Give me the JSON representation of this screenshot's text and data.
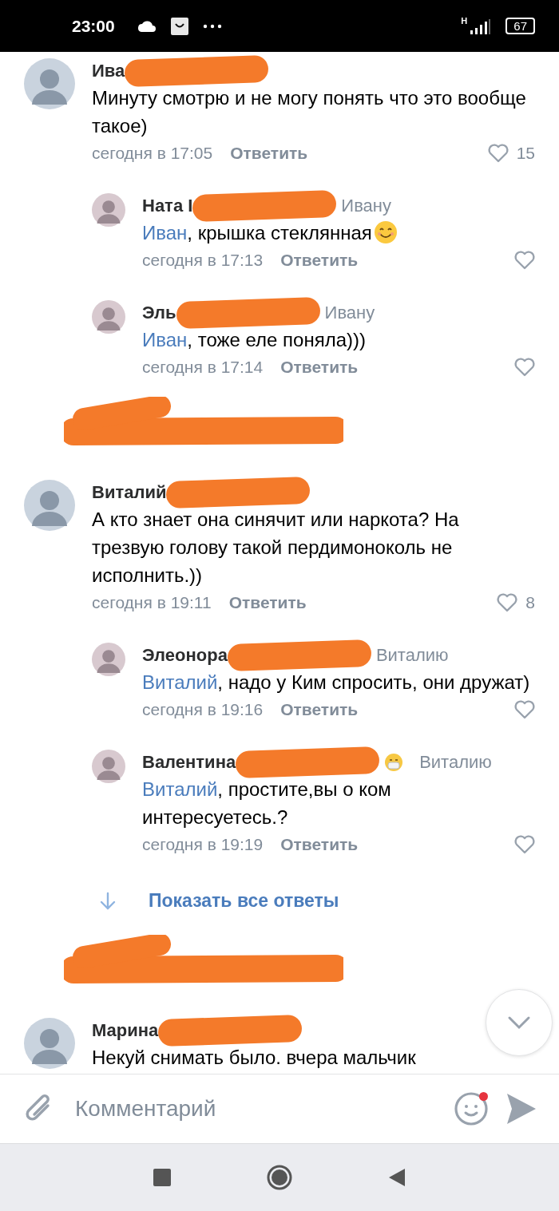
{
  "status_bar": {
    "time": "23:00",
    "network": "H",
    "battery": "67"
  },
  "feed": [
    {
      "kind": "comment",
      "author": "Ива",
      "author_redacted": true,
      "text": "Минуту смотрю и не могу понять что это вообще такое)",
      "time": "сегодня в 17:05",
      "reply_label": "Ответить",
      "likes": "15",
      "liked": false,
      "replies": [
        {
          "author": "Ната I",
          "author_redacted": true,
          "to": "Ивану",
          "mention": "Иван",
          "text": ", крышка стеклянная",
          "smiley": true,
          "time": "сегодня в 17:13",
          "reply_label": "Ответить",
          "liked": false
        },
        {
          "author": "Эль",
          "author_redacted": true,
          "to": "Ивану",
          "mention": "Иван",
          "text": ", тоже еле поняла)))",
          "smiley": false,
          "time": "сегодня в 17:14",
          "reply_label": "Ответить",
          "liked": false
        }
      ]
    },
    {
      "kind": "redacted"
    },
    {
      "kind": "comment",
      "author": "Виталий",
      "author_redacted": true,
      "text": "А кто знает она синячит или наркота? На трезвую голову такой пердимоноколь не исполнить.))",
      "time": "сегодня в 19:11",
      "reply_label": "Ответить",
      "likes": "8",
      "liked": false,
      "replies": [
        {
          "author": "Элеонора",
          "author_redacted": true,
          "to": "Виталию",
          "mention": "Виталий",
          "text": ", надо у Ким спросить, они дружат)",
          "smiley": false,
          "time": "сегодня в 19:16",
          "reply_label": "Ответить",
          "liked": false
        },
        {
          "author": "Валентина",
          "author_redacted": true,
          "mask_emoji": true,
          "to": "Виталию",
          "mention": "Виталий",
          "text": ", простите,вы о ком интересуетесь.?",
          "smiley": false,
          "time": "сегодня в 19:19",
          "reply_label": "Ответить",
          "liked": false
        }
      ],
      "show_all": "Показать все ответы"
    },
    {
      "kind": "redacted"
    },
    {
      "kind": "comment",
      "author": "Марина",
      "author_redacted": true,
      "text": "Некуй снимать было. вчера мальчик"
    }
  ],
  "composer": {
    "placeholder": "Комментарий",
    "emoji_badge": true
  }
}
